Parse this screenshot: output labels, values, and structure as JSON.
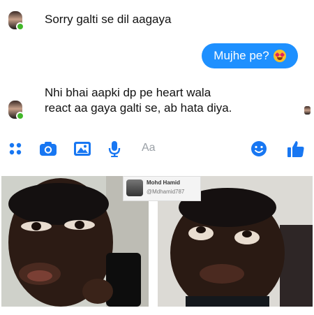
{
  "chat": {
    "messages": [
      {
        "from": "them",
        "text": "Sorry galti se dil aagaya"
      },
      {
        "from": "me",
        "text": "Mujhe pe?",
        "emoji": "heart-eyes-emoji"
      },
      {
        "from": "them",
        "lines": [
          "Nhi bhai aapki dp pe heart wala",
          "react aa gaya galti se, ab hata diya."
        ]
      }
    ]
  },
  "composer": {
    "placeholder": "Aa",
    "icons": [
      "apps-icon",
      "camera-icon",
      "image-icon",
      "microphone-icon",
      "emoji-icon",
      "like-icon"
    ],
    "accent": "#1877f2"
  },
  "meme": {
    "credit_name": "Mohd Hamid",
    "credit_handle": "@Mdhamid787"
  }
}
